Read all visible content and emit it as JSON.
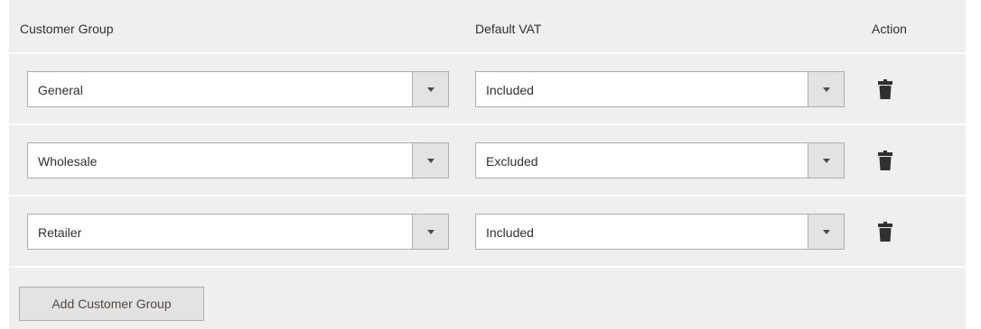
{
  "columns": {
    "customer_group": "Customer Group",
    "default_vat": "Default VAT",
    "action": "Action"
  },
  "rows": [
    {
      "customer_group": "General",
      "default_vat": "Included",
      "action_icon": "trash-icon"
    },
    {
      "customer_group": "Wholesale",
      "default_vat": "Excluded",
      "action_icon": "trash-icon"
    },
    {
      "customer_group": "Retailer",
      "default_vat": "Included",
      "action_icon": "trash-icon"
    }
  ],
  "add_button_label": "Add Customer Group",
  "colors": {
    "panel_background": "#efefef",
    "field_border": "#adadad",
    "arrow_box_background": "#e3e3e3",
    "text": "#303030",
    "icon": "#303030"
  }
}
